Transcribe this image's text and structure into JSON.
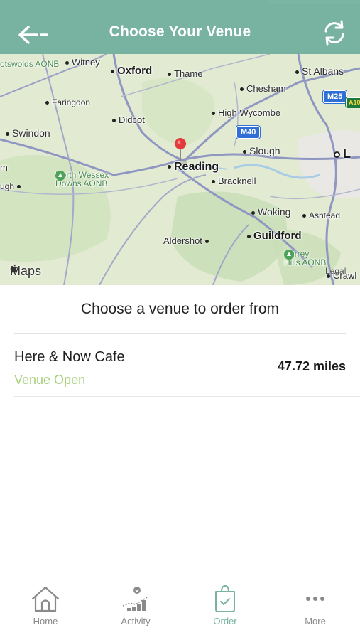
{
  "header": {
    "title": "Choose Your Venue",
    "back_icon": "back-arrow-icon",
    "refresh_icon": "refresh-icon",
    "bg_color": "#77b3a0"
  },
  "map": {
    "attribution": "Maps",
    "legal": "Legal",
    "places": {
      "witney": "Witney",
      "oxford": "Oxford",
      "thame": "Thame",
      "st_albans": "St Albans",
      "cotswolds": "otswolds AONB",
      "chesham": "Chesham",
      "faringdon": "Faringdon",
      "high_wycombe": "High Wycombe",
      "didcot": "Didcot",
      "swindon": "Swindon",
      "slough": "Slough",
      "reading": "Reading",
      "north_wessex": "North Wessex",
      "downs_aonb": "Downs AONB",
      "bracknell": "Bracknell",
      "woking": "Woking",
      "ashtead": "Ashtead",
      "aldershot": "Aldershot",
      "guildford": "Guildford",
      "surrey": "Surrey",
      "hills_aonb": "Hills AONB",
      "crawley": "Crawl",
      "ugh": "ugh",
      "m_left": "m",
      "london": "L"
    },
    "roads": {
      "m25": "M25",
      "m40": "M40",
      "a10": "A10"
    }
  },
  "content": {
    "subtitle": "Choose a venue to order from",
    "venues": [
      {
        "name": "Here & Now Cafe",
        "status": "Venue Open",
        "distance": "47.72 miles"
      }
    ]
  },
  "tabbar": {
    "tabs": [
      {
        "label": "Home",
        "icon": "home-icon"
      },
      {
        "label": "Activity",
        "icon": "activity-icon"
      },
      {
        "label": "Order",
        "icon": "shopping-bag-icon",
        "active": true
      },
      {
        "label": "More",
        "icon": "more-icon"
      }
    ],
    "active_color": "#77b3a0"
  }
}
